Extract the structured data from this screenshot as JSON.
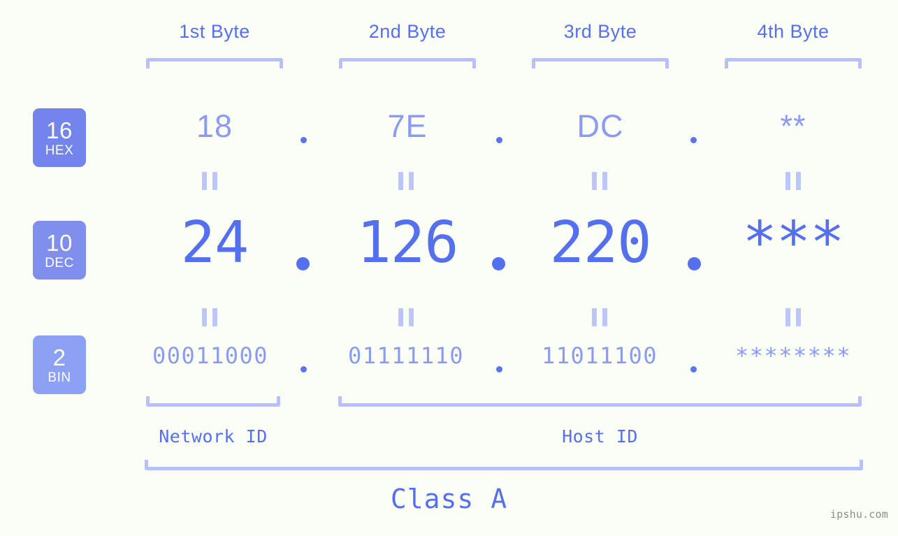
{
  "background_color": "#fbfdf7",
  "accent_color": "#5570ee",
  "muted_accent_color": "#8b9bf3",
  "bracket_color": "#b6c0fb",
  "headers": {
    "bytes": [
      {
        "label": "1st Byte"
      },
      {
        "label": "2nd Byte"
      },
      {
        "label": "3rd Byte"
      },
      {
        "label": "4th Byte"
      }
    ]
  },
  "badges": [
    {
      "number": "16",
      "name": "HEX",
      "color": "#7384ec"
    },
    {
      "number": "10",
      "name": "DEC",
      "color": "#808eee"
    },
    {
      "number": "2",
      "name": "BIN",
      "color": "#8da1f4"
    }
  ],
  "rows": {
    "hex": {
      "values": [
        "18",
        "7E",
        "DC",
        "**"
      ],
      "separator": "."
    },
    "dec": {
      "values": [
        "24",
        "126",
        "220",
        "***"
      ],
      "separator": "."
    },
    "bin": {
      "values": [
        "00011000",
        "01111110",
        "11011100",
        "********"
      ],
      "separator": "."
    }
  },
  "equality_marks": {
    "hex_to_dec": [
      "||",
      "||",
      "||",
      "||"
    ],
    "dec_to_bin": [
      "||",
      "||",
      "||",
      "||"
    ]
  },
  "footer": {
    "network_id_label": "Network ID",
    "host_id_label": "Host ID",
    "class_label": "Class A"
  },
  "watermark": "ipshu.com"
}
